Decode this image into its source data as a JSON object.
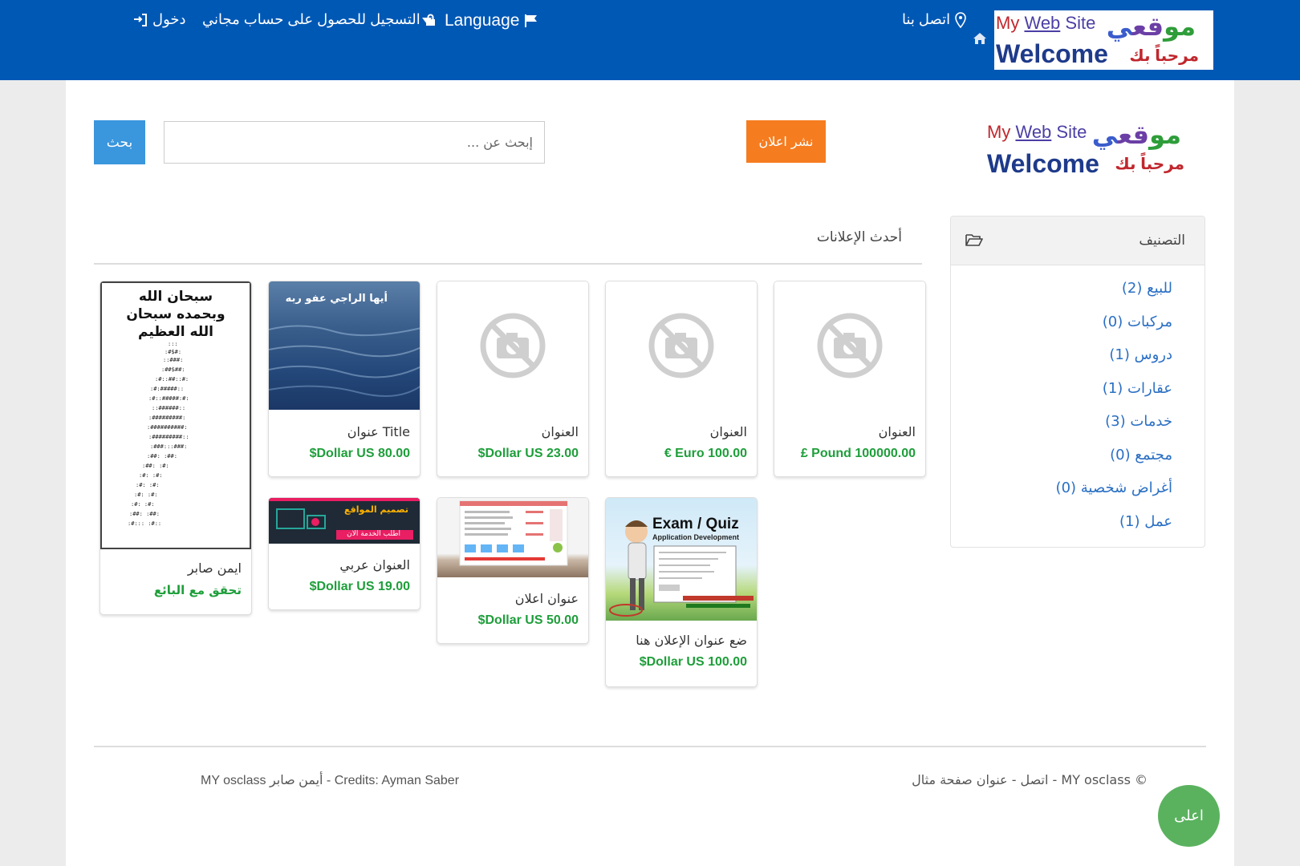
{
  "header": {
    "language_label": "Language",
    "register_label": "التسجيل للحصول على حساب مجاني",
    "login_label": "دخول",
    "contact_label": "اتصل بنا"
  },
  "logo": {
    "en_my": "My",
    "en_web": "Web",
    "en_site": "Site",
    "welcome": "Welcome",
    "ar_main_1": "مو",
    "ar_main_2": "قع",
    "ar_main_3": "ي",
    "ar_sub": "مرحباً بك"
  },
  "search": {
    "placeholder": "إبحث عن ...",
    "button_label": "بحث"
  },
  "publish_label": "نشر اعلان",
  "categories": {
    "title": "التصنيف",
    "items": [
      {
        "label": "للبيع (2)"
      },
      {
        "label": "مركبات (0)"
      },
      {
        "label": "دروس (1)"
      },
      {
        "label": "عقارات (1)"
      },
      {
        "label": "خدمات (3)"
      },
      {
        "label": "مجتمع (0)"
      },
      {
        "label": "أغراض شخصية (0)"
      },
      {
        "label": "عمل (1)"
      }
    ]
  },
  "latest_title": "أحدث الإعلانات",
  "listings": [
    {
      "title": "العنوان",
      "price": "£ Pound 100000.00",
      "image": "no-image"
    },
    {
      "title": "العنوان",
      "price": "€ Euro 100.00",
      "image": "no-image"
    },
    {
      "title": "العنوان",
      "price": "$Dollar US 23.00",
      "image": "no-image"
    },
    {
      "title": "Title عنوان",
      "price": "$Dollar US 80.00",
      "image": "water-photo",
      "image_text": "أيها الراجي عفو ربه"
    },
    {
      "title": "ايمن صابر",
      "price": "تحقق مع البائع",
      "image": "calligraphy",
      "image_text": "سبحان الله وبحمده سبحان الله العظيم"
    },
    {
      "title": "ضع عنوان الإعلان هنا",
      "price": "$Dollar US 100.00",
      "image": "exam-quiz",
      "image_text": "Exam / Quiz",
      "image_subtext": "Application Development"
    },
    {
      "title": "عنوان اعلان",
      "price": "$Dollar US 50.00",
      "image": "website-screenshot"
    },
    {
      "title": "العنوان عربي",
      "price": "$Dollar US 19.00",
      "image": "web-design-banner",
      "image_text": "تصميم المواقع",
      "image_subtext": "اطلب الخدمة الان"
    }
  ],
  "footer": {
    "left": "MY osclass أيمن صابر - Credits: Ayman Saber",
    "right": "© MY osclass - اتصل - عنوان صفحة مثال",
    "top_button": "اعلى"
  },
  "colors": {
    "header_bg": "#0058b5",
    "search_button": "#3a96dd",
    "publish_button": "#f57d20",
    "price_green": "#1e9e3a",
    "link_blue": "#2a6fc4",
    "top_button": "#5ab25e"
  }
}
